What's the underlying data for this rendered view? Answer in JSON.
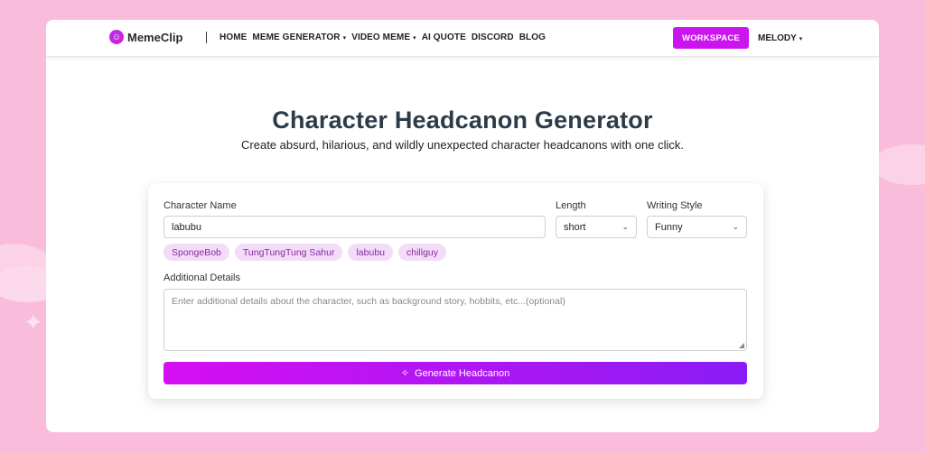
{
  "nav": {
    "brand": "MemeClip",
    "links": [
      {
        "label": "HOME",
        "dropdown": false
      },
      {
        "label": "MEME GENERATOR",
        "dropdown": true
      },
      {
        "label": "VIDEO MEME",
        "dropdown": true
      },
      {
        "label": "AI QUOTE",
        "dropdown": false
      },
      {
        "label": "DISCORD",
        "dropdown": false
      },
      {
        "label": "BLOG",
        "dropdown": false
      }
    ],
    "caret": "▾",
    "workspace_label": "WORKSPACE",
    "user_label": "MELODY"
  },
  "hero": {
    "title": "Character Headcanon Generator",
    "subtitle": "Create absurd, hilarious, and wildly unexpected character headcanons with one click."
  },
  "form": {
    "character_label": "Character Name",
    "character_value": "labubu",
    "length_label": "Length",
    "length_value": "short",
    "style_label": "Writing Style",
    "style_value": "Funny",
    "suggestions": [
      "SpongeBob",
      "TungTungTung Sahur",
      "labubu",
      "chillguy"
    ],
    "details_label": "Additional Details",
    "details_placeholder": "Enter additional details about the character, such as background story, hobbits, etc...(optional)",
    "generate_label": "Generate Headcanon"
  },
  "colors": {
    "background": "#f9bddb",
    "accent": "#cc14f0",
    "chip_bg": "#f2dcf7",
    "button_gradient_start": "#d60ff2",
    "button_gradient_end": "#8a1cf5"
  },
  "icons": {
    "brand_logo": "smiley-icon",
    "generate": "sparkle-icon",
    "select": "chevron-down-icon"
  }
}
